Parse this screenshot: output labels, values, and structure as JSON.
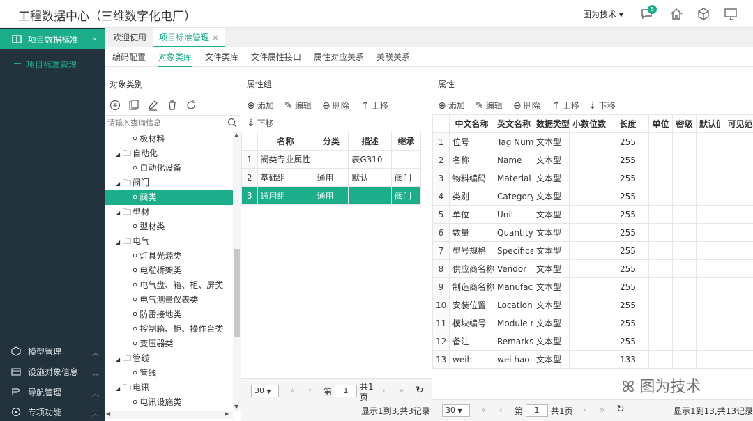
{
  "header": {
    "title": "工程数据中心（三维数字化电厂）",
    "user": "图为技术",
    "notif_count": "5"
  },
  "sidebar": {
    "active_label": "项目数据标准",
    "sub_label": "项目标准管理",
    "bottom_items": [
      {
        "label": "模型管理",
        "icon": "model-icon"
      },
      {
        "label": "设施对象信息",
        "icon": "facility-icon"
      },
      {
        "label": "导航管理",
        "icon": "navigation-icon"
      },
      {
        "label": "专项功能",
        "icon": "special-icon"
      }
    ]
  },
  "tabs": [
    {
      "label": "欢迎使用"
    },
    {
      "label": "项目标准管理",
      "close": "×"
    }
  ],
  "subtabs": [
    "编码配置",
    "对象类库",
    "文件类库",
    "文件属性接口",
    "属性对应关系",
    "关联关系"
  ],
  "left_panel": {
    "title": "对象类别",
    "search_placeholder": "请输入查询信息",
    "tree": [
      {
        "label": "板材料",
        "level": 2
      },
      {
        "label": "自动化",
        "level": 1
      },
      {
        "label": "自动化设备",
        "level": 2
      },
      {
        "label": "阀门",
        "level": 1
      },
      {
        "label": "阀类",
        "level": 2,
        "selected": true
      },
      {
        "label": "型材",
        "level": 1
      },
      {
        "label": "型材类",
        "level": 2
      },
      {
        "label": "电气",
        "level": 1
      },
      {
        "label": "灯具光源类",
        "level": 2
      },
      {
        "label": "电缆桥架类",
        "level": 2
      },
      {
        "label": "电气盘、箱、柜、屏类",
        "level": 2
      },
      {
        "label": "电气测量仪表类",
        "level": 2
      },
      {
        "label": "防雷接地类",
        "level": 2
      },
      {
        "label": "控制箱、柜、操作台类",
        "level": 2
      },
      {
        "label": "变压器类",
        "level": 2
      },
      {
        "label": "管线",
        "level": 1
      },
      {
        "label": "管线",
        "level": 2
      },
      {
        "label": "电讯",
        "level": 1
      },
      {
        "label": "电讯设施类",
        "level": 2
      }
    ],
    "pager": {
      "size": "30",
      "page_label": "第",
      "page": "1",
      "total_label": "共1",
      "page_unit": "页"
    }
  },
  "middle_panel": {
    "title": "属性组",
    "tools": {
      "add": "添加",
      "edit": "编辑",
      "delete": "删除",
      "up": "上移",
      "down": "下移"
    },
    "columns": [
      "名称",
      "分类",
      "描述",
      "继承"
    ],
    "rows": [
      {
        "no": "1",
        "name": "阀类专业属性",
        "cat": "",
        "desc": "表G310",
        "inherit": ""
      },
      {
        "no": "2",
        "name": "基础组",
        "cat": "通用",
        "desc": "默认",
        "inherit": "阀门"
      },
      {
        "no": "3",
        "name": "通用组",
        "cat": "通用",
        "desc": "",
        "inherit": "阀门",
        "selected": true
      }
    ],
    "status": "显示1到3,共3记录"
  },
  "right_panel": {
    "title": "属性",
    "tools": {
      "add": "添加",
      "edit": "编辑",
      "delete": "删除",
      "up": "上移",
      "down": "下移"
    },
    "columns": [
      "中文名称",
      "英文名称",
      "数据类型",
      "小数位数",
      "长度",
      "单位",
      "密级",
      "默认值",
      "可见范"
    ],
    "rows": [
      {
        "no": "1",
        "cn": "位号",
        "en": "Tag Num",
        "type": "文本型",
        "len": "255"
      },
      {
        "no": "2",
        "cn": "名称",
        "en": "Name",
        "type": "文本型",
        "len": "255"
      },
      {
        "no": "3",
        "cn": "物料编码",
        "en": "Material C",
        "type": "文本型",
        "len": "255"
      },
      {
        "no": "4",
        "cn": "类别",
        "en": "Category",
        "type": "文本型",
        "len": "255"
      },
      {
        "no": "5",
        "cn": "单位",
        "en": "Unit",
        "type": "文本型",
        "len": "255"
      },
      {
        "no": "6",
        "cn": "数量",
        "en": "Quantity",
        "type": "文本型",
        "len": "255"
      },
      {
        "no": "7",
        "cn": "型号规格",
        "en": "Specificat",
        "type": "文本型",
        "len": "255"
      },
      {
        "no": "8",
        "cn": "供应商名称",
        "en": "Vendor",
        "type": "文本型",
        "len": "255"
      },
      {
        "no": "9",
        "cn": "制造商名称",
        "en": "Manufact",
        "type": "文本型",
        "len": "255"
      },
      {
        "no": "10",
        "cn": "安装位置",
        "en": "Location",
        "type": "文本型",
        "len": "255"
      },
      {
        "no": "11",
        "cn": "模块编号",
        "en": "Module n",
        "type": "文本型",
        "len": "255"
      },
      {
        "no": "12",
        "cn": "备注",
        "en": "Remarks",
        "type": "文本型",
        "len": "255"
      },
      {
        "no": "13",
        "cn": "weih",
        "en": "wei hao",
        "type": "文本型",
        "len": "133"
      }
    ],
    "pager": {
      "size": "30",
      "page_label": "第",
      "page": "1",
      "total_label": "共1页"
    },
    "status": "显示1到13,共13记录"
  },
  "watermark": "图为技术"
}
